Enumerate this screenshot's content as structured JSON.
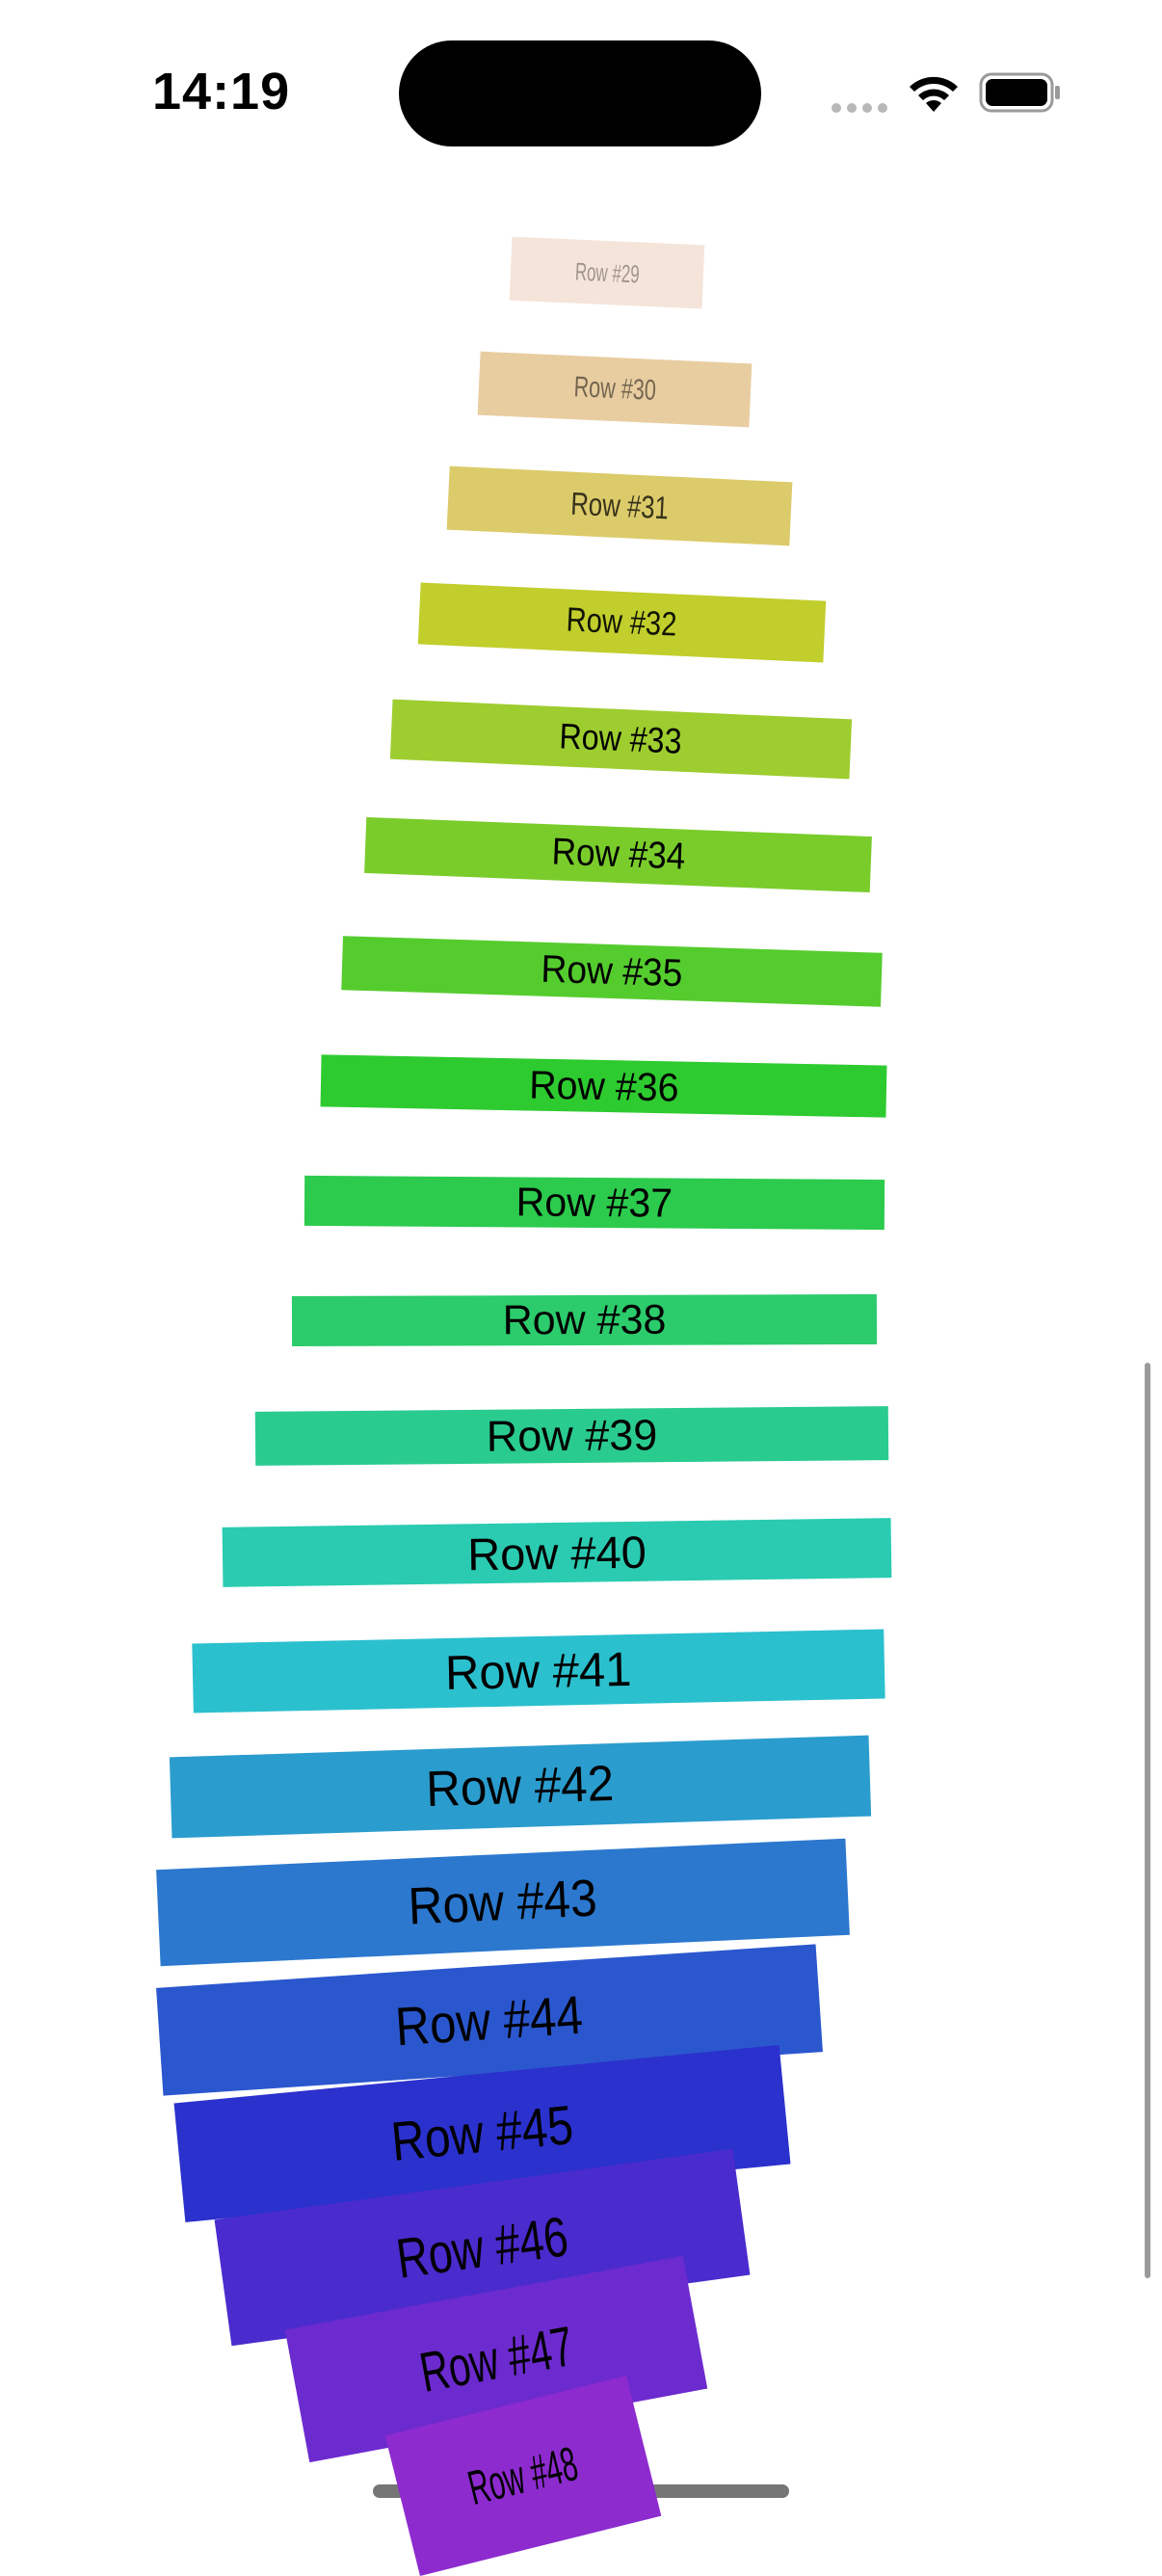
{
  "status_bar": {
    "time": "14:19"
  },
  "rows": [
    {
      "label": "Row #29",
      "color": "#F5E4D9",
      "text_opacity": 0.35
    },
    {
      "label": "Row #30",
      "color": "#E8CDA1",
      "text_opacity": 0.5
    },
    {
      "label": "Row #31",
      "color": "#DCCB6A",
      "text_opacity": 0.75
    },
    {
      "label": "Row #32",
      "color": "#C1CE2C",
      "text_opacity": 0.9
    },
    {
      "label": "Row #33",
      "color": "#9ECD2F",
      "text_opacity": 1
    },
    {
      "label": "Row #34",
      "color": "#7ACC2B",
      "text_opacity": 1
    },
    {
      "label": "Row #35",
      "color": "#55CC2E",
      "text_opacity": 1
    },
    {
      "label": "Row #36",
      "color": "#2DCB2F",
      "text_opacity": 1
    },
    {
      "label": "Row #37",
      "color": "#2CCB4E",
      "text_opacity": 1
    },
    {
      "label": "Row #38",
      "color": "#2CCB6C",
      "text_opacity": 1
    },
    {
      "label": "Row #39",
      "color": "#2ACB8F",
      "text_opacity": 1
    },
    {
      "label": "Row #40",
      "color": "#2ACBB1",
      "text_opacity": 1
    },
    {
      "label": "Row #41",
      "color": "#2BC0CE",
      "text_opacity": 1
    },
    {
      "label": "Row #42",
      "color": "#2B9CCE",
      "text_opacity": 1
    },
    {
      "label": "Row #43",
      "color": "#2B78CE",
      "text_opacity": 1
    },
    {
      "label": "Row #44",
      "color": "#2B57CE",
      "text_opacity": 1
    },
    {
      "label": "Row #45",
      "color": "#2B31CD",
      "text_opacity": 1
    },
    {
      "label": "Row #46",
      "color": "#4A2BCE",
      "text_opacity": 1
    },
    {
      "label": "Row #47",
      "color": "#6C2BCE",
      "text_opacity": 1
    },
    {
      "label": "Row #48",
      "color": "#8D2BCF",
      "text_opacity": 1
    }
  ]
}
